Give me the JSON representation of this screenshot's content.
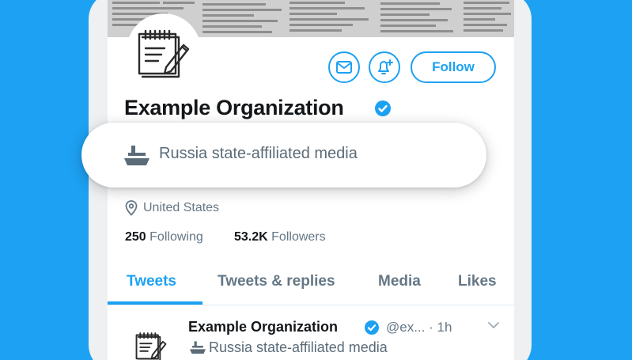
{
  "colors": {
    "background": "#1da1f2",
    "accent": "#1da1f2",
    "text_primary": "#14171a",
    "text_secondary": "#657786"
  },
  "profile": {
    "name": "Example Organization",
    "verified": true,
    "state_label": "Russia state-affiliated media",
    "location": "United States",
    "following_count": "250",
    "following_label": "Following",
    "followers_count": "53.2K",
    "followers_label": "Followers"
  },
  "actions": {
    "message_icon": "envelope-icon",
    "notify_icon": "bell-plus-icon",
    "follow_label": "Follow"
  },
  "tabs": [
    {
      "label": "Tweets",
      "active": true
    },
    {
      "label": "Tweets & replies",
      "active": false
    },
    {
      "label": "Media",
      "active": false
    },
    {
      "label": "Likes",
      "active": false
    }
  ],
  "tweet": {
    "author": "Example Organization",
    "meta": "@ex... · 1h",
    "state_label": "Russia state-affiliated media"
  }
}
